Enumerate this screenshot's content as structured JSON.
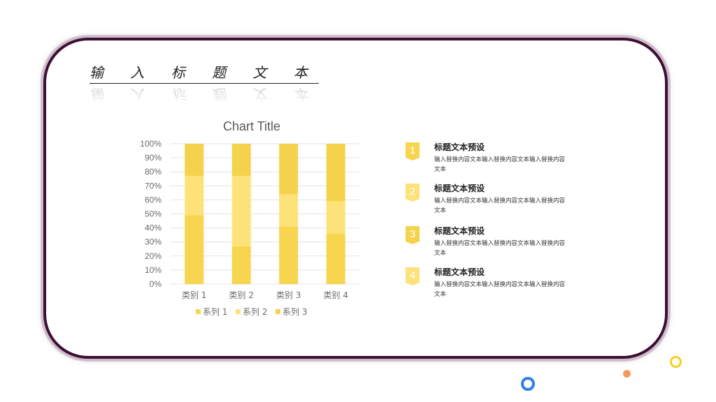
{
  "slide": {
    "title": "输 入 标 题 文 本"
  },
  "chart_data": {
    "type": "bar",
    "stacked": "percent",
    "title": "Chart Title",
    "categories": [
      "类别 1",
      "类别 2",
      "类别 3",
      "类别 4"
    ],
    "y_ticks": [
      "0%",
      "10%",
      "20%",
      "30%",
      "40%",
      "50%",
      "60%",
      "70%",
      "80%",
      "90%",
      "100%"
    ],
    "ylim": [
      0,
      100
    ],
    "series": [
      {
        "name": "系列 1",
        "values": [
          49,
          27,
          41,
          36
        ],
        "color": "#f7d54f"
      },
      {
        "name": "系列 2",
        "values": [
          28,
          50,
          23,
          23
        ],
        "color": "#fde27a"
      },
      {
        "name": "系列 3",
        "values": [
          23,
          23,
          36,
          41
        ],
        "color": "#f5d24c"
      }
    ],
    "legend": "bottom",
    "grid": true
  },
  "items": [
    {
      "num": "1",
      "title": "标题文本预设",
      "body": "输入替换内容文本输入替换内容文本输入替换内容文本"
    },
    {
      "num": "2",
      "title": "标题文本预设",
      "body": "输入替换内容文本输入替换内容文本输入替换内容文本"
    },
    {
      "num": "3",
      "title": "标题文本预设",
      "body": "输入替换内容文本输入替换内容文本输入替换内容文本"
    },
    {
      "num": "4",
      "title": "标题文本预设",
      "body": "输入替换内容文本输入替换内容文本输入替换内容文本"
    }
  ],
  "colors": {
    "frame": "#3d0f33",
    "accent": "#f7d54f",
    "dot_orange": "#f59a5a",
    "dot_blue": "#2f7ef0",
    "dot_yellow": "#f5d020"
  }
}
